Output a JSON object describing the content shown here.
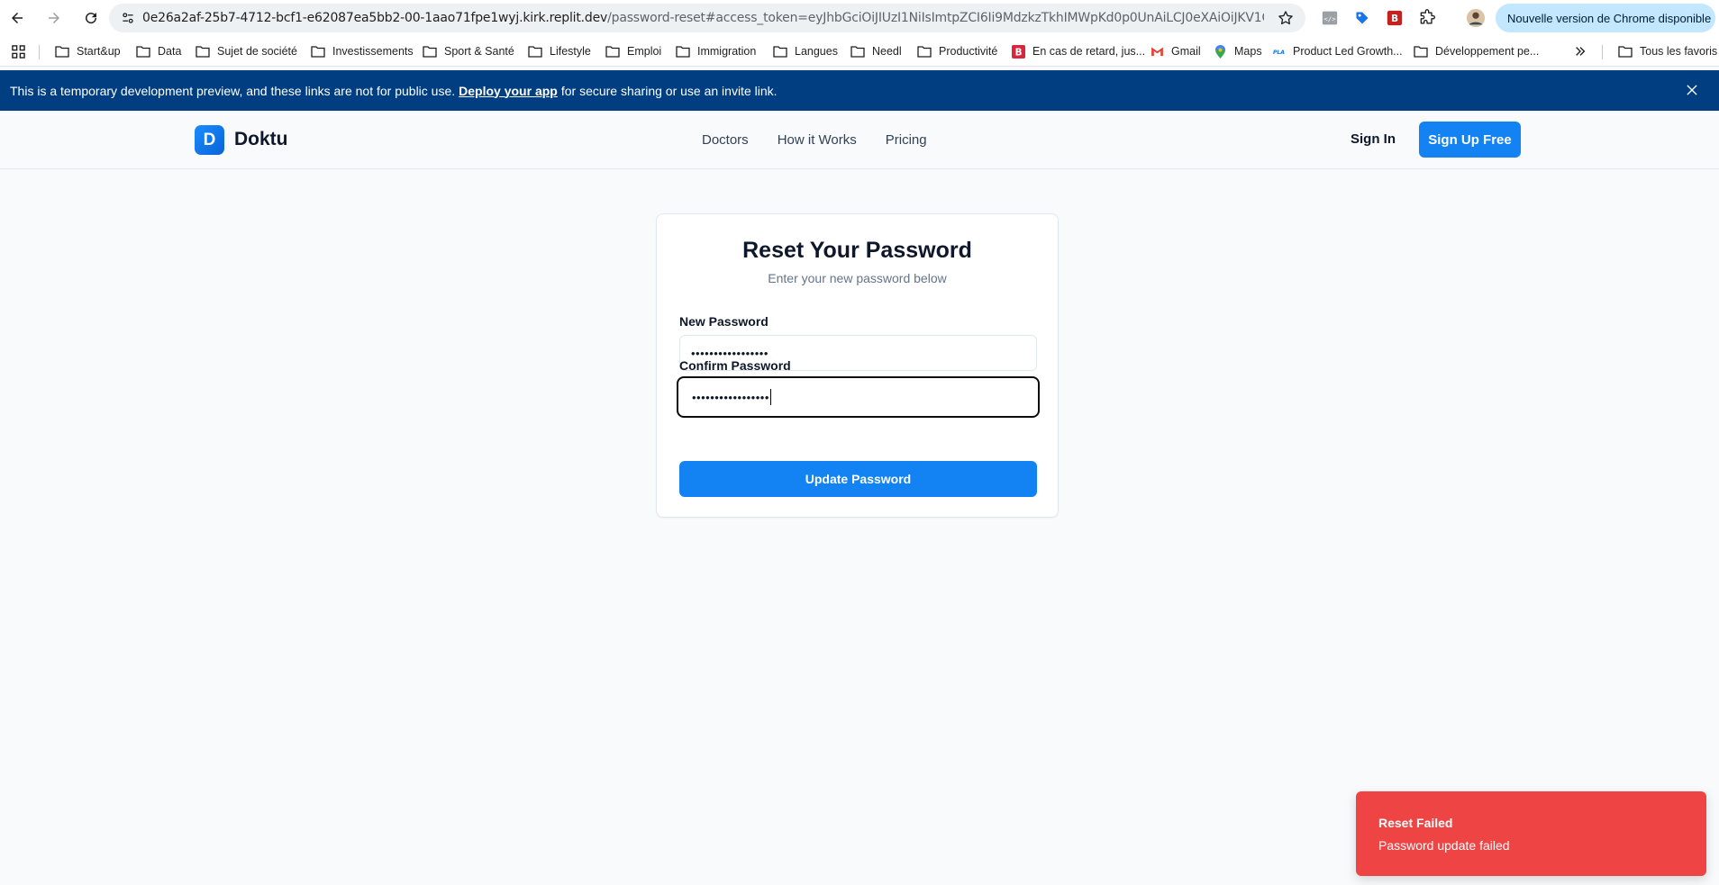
{
  "browser": {
    "url_host": "0e26a2af-25b7-4712-bcf1-e62087ea5bb2-00-1aao71fpe1wyj.kirk.replit.dev",
    "url_path": "/password-reset#access_token=eyJhbGciOiJIUzI1NiIsImtpZCI6Ii9MdzkzTkhIMWpKd0p0UnAiLCJ0eXAiOiJKV1QifQ.eyJpc3MiOiJ...",
    "update_label": "Nouvelle version de Chrome disponible"
  },
  "bookmarks": {
    "items": [
      {
        "label": "Start&up",
        "icon": "folder-icon"
      },
      {
        "label": "Data",
        "icon": "folder-icon"
      },
      {
        "label": "Sujet de société",
        "icon": "folder-icon"
      },
      {
        "label": "Investissements",
        "icon": "folder-icon"
      },
      {
        "label": "Sport & Santé",
        "icon": "folder-icon"
      },
      {
        "label": "Lifestyle",
        "icon": "folder-icon"
      },
      {
        "label": "Emploi",
        "icon": "folder-icon"
      },
      {
        "label": "Immigration",
        "icon": "folder-icon"
      },
      {
        "label": "Langues",
        "icon": "folder-icon"
      },
      {
        "label": "Needl",
        "icon": "folder-icon"
      },
      {
        "label": "Productivité",
        "icon": "folder-icon"
      },
      {
        "label": "En cas de retard, jus...",
        "icon": "b-logo-icon"
      },
      {
        "label": "Gmail",
        "icon": "gmail-icon"
      },
      {
        "label": "Maps",
        "icon": "maps-pin-icon"
      },
      {
        "label": "Product Led Growth...",
        "icon": "pla-icon"
      },
      {
        "label": "Développement pe...",
        "icon": "folder-icon"
      }
    ],
    "all_bookmarks": "Tous les favoris"
  },
  "banner": {
    "text_before": "This is a temporary development preview, and these links are not for public use.",
    "link": "Deploy your app",
    "text_after": "for secure sharing or use an invite link.",
    "color": "#003e82"
  },
  "header": {
    "logo_letter": "D",
    "brand": "Doktu",
    "nav": [
      "Doctors",
      "How it Works",
      "Pricing"
    ],
    "sign_in": "Sign In",
    "sign_up": "Sign Up Free",
    "accent": "#1383f4"
  },
  "form": {
    "title": "Reset Your Password",
    "subtitle": "Enter your new password below",
    "new_password_label": "New Password",
    "new_password_value": "•••••••••••••••••",
    "confirm_password_label": "Confirm Password",
    "confirm_password_value": "•••••••••••••••••",
    "submit_label": "Update Password"
  },
  "toast": {
    "title": "Reset Failed",
    "description": "Password update failed",
    "color": "#ef4444"
  }
}
